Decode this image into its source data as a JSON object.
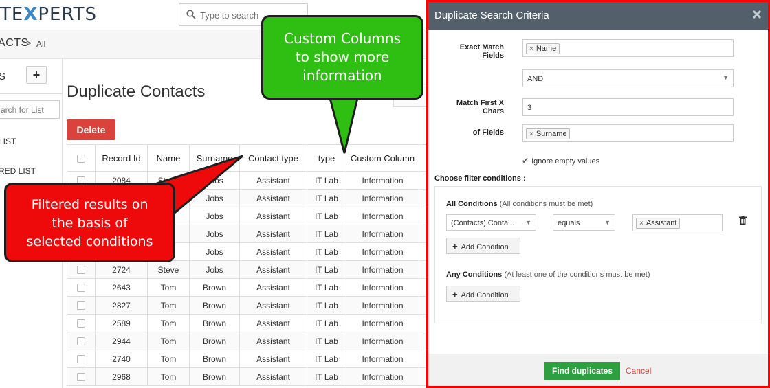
{
  "header": {
    "logo_prefix": "TE",
    "logo_x": "X",
    "logo_suffix": "PERTS",
    "search_placeholder": "Type to search"
  },
  "breadcrumb": {
    "module": "ACTS",
    "separator": ">",
    "view": "All"
  },
  "sidebar": {
    "title": "S",
    "add_label": "+",
    "search_placeholder": "arch for List",
    "items": [
      "LIST",
      "RED LIST"
    ]
  },
  "main": {
    "title": "Duplicate Contacts",
    "delete_label": "Delete",
    "columns": [
      "Record Id",
      "Name",
      "Surname",
      "Contact type",
      "type",
      "Custom Column"
    ],
    "rows": [
      {
        "id": "2084",
        "name": "Steve",
        "surname": "Jobs",
        "ctype": "Assistant",
        "type": "IT Lab",
        "custom": "Information"
      },
      {
        "id": "",
        "name": "",
        "surname": "Jobs",
        "ctype": "Assistant",
        "type": "IT Lab",
        "custom": "Information"
      },
      {
        "id": "",
        "name": "",
        "surname": "Jobs",
        "ctype": "Assistant",
        "type": "IT Lab",
        "custom": "Information"
      },
      {
        "id": "",
        "name": "",
        "surname": "Jobs",
        "ctype": "Assistant",
        "type": "IT Lab",
        "custom": "Information"
      },
      {
        "id": "",
        "name": "",
        "surname": "Jobs",
        "ctype": "Assistant",
        "type": "IT Lab",
        "custom": "Information"
      },
      {
        "id": "2724",
        "name": "Steve",
        "surname": "Jobs",
        "ctype": "Assistant",
        "type": "IT Lab",
        "custom": "Information"
      },
      {
        "id": "2643",
        "name": "Tom",
        "surname": "Brown",
        "ctype": "Assistant",
        "type": "IT Lab",
        "custom": "Information"
      },
      {
        "id": "2827",
        "name": "Tom",
        "surname": "Brown",
        "ctype": "Assistant",
        "type": "IT Lab",
        "custom": "Information"
      },
      {
        "id": "2589",
        "name": "Tom",
        "surname": "Brown",
        "ctype": "Assistant",
        "type": "IT Lab",
        "custom": "Information"
      },
      {
        "id": "2944",
        "name": "Tom",
        "surname": "Brown",
        "ctype": "Assistant",
        "type": "IT Lab",
        "custom": "Information"
      },
      {
        "id": "2740",
        "name": "Tom",
        "surname": "Brown",
        "ctype": "Assistant",
        "type": "IT Lab",
        "custom": "Information"
      },
      {
        "id": "2968",
        "name": "Tom",
        "surname": "Brown",
        "ctype": "Assistant",
        "type": "IT Lab",
        "custom": "Information"
      }
    ]
  },
  "callouts": {
    "green": [
      "Custom Columns",
      "to show more",
      "information"
    ],
    "red": [
      "Filtered results on",
      "the basis of",
      "selected conditions"
    ]
  },
  "modal": {
    "title": "Duplicate Search Criteria",
    "exact_label": "Exact Match Fields",
    "exact_tag": "Name",
    "operator": "AND",
    "first_chars_label": "Match First X Chars",
    "first_chars_value": "3",
    "of_fields_label": "of Fields",
    "of_fields_tag": "Surname",
    "ignore_empty": "Ignore empty values",
    "filter_section": "Choose filter conditions :",
    "all_title": "All Conditions",
    "all_sub": "(All conditions must be met)",
    "cond_field": "(Contacts) Conta...",
    "cond_op": "equals",
    "cond_value": "Assistant",
    "add_condition": "Add Condition",
    "any_title": "Any Conditions",
    "any_sub": "(At least one of the conditions must be met)",
    "find_label": "Find duplicates",
    "cancel_label": "Cancel"
  },
  "colors": {
    "delete": "#d9433b",
    "callout_green": "#2fbf12",
    "callout_red": "#ee0a0a",
    "modal_header": "#53606b",
    "modal_border": "#ff0000",
    "find": "#2ca03e"
  }
}
